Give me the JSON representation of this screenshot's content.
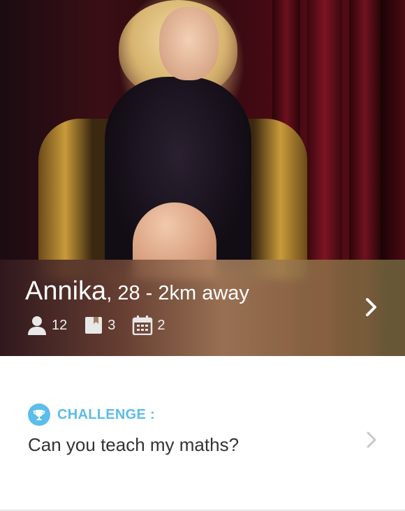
{
  "profile": {
    "name": "Annika",
    "details": ", 28 - 2km away",
    "stats": [
      {
        "icon": "person-icon",
        "value": "12"
      },
      {
        "icon": "book-icon",
        "value": "3"
      },
      {
        "icon": "calendar-icon",
        "value": "2"
      }
    ]
  },
  "challenge": {
    "label": "CHALLENGE :",
    "text": "Can you teach my maths?",
    "icon": "trophy-icon"
  },
  "colors": {
    "accent": "#5bbde9",
    "text": "#333333",
    "chevron_grey": "#c8c8c8"
  }
}
